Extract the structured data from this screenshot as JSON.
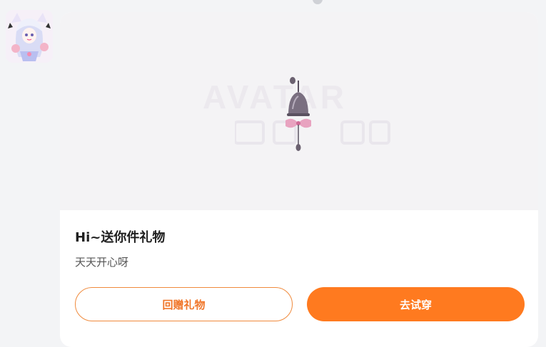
{
  "card": {
    "title": "Hi~送你件礼物",
    "subtitle": "天天开心呀",
    "image_icon": "wind-chime-bell",
    "watermark_text": "AVATAR"
  },
  "buttons": {
    "return_gift_label": "回赠礼物",
    "try_on_label": "去试穿"
  },
  "colors": {
    "accent": "#ff7a1f",
    "accent_border": "#f08a3c",
    "card_bg": "#ffffff",
    "page_bg": "#f3f4f6",
    "image_bg": "#f4f3f5"
  }
}
